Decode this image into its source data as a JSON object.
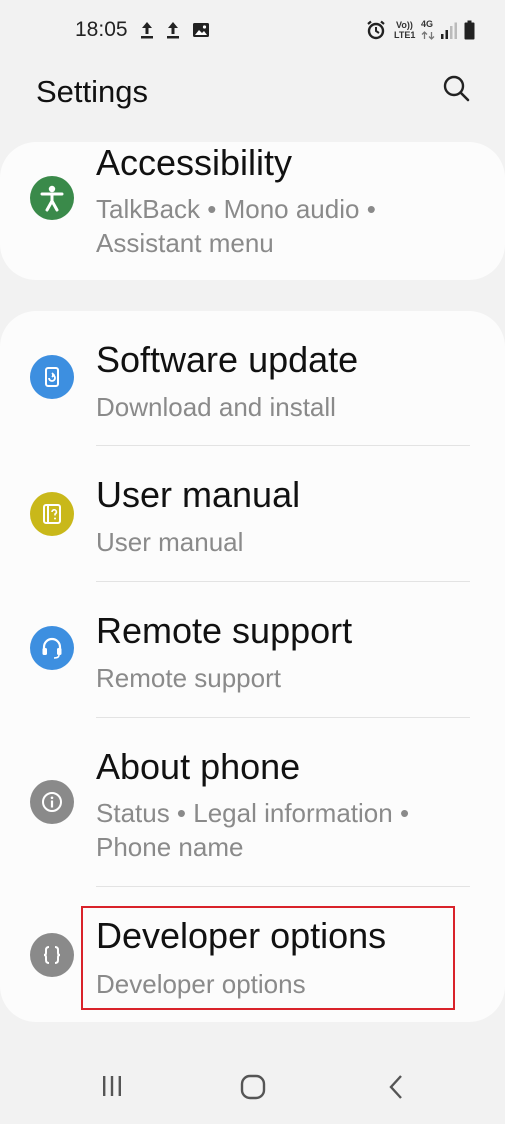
{
  "status_bar": {
    "time": "18:05",
    "left_icons": [
      "upload-icon",
      "upload-icon",
      "image-icon"
    ],
    "right_icons": [
      "alarm-icon",
      "volte-icon",
      "4g-icon",
      "signal-icon",
      "battery-icon"
    ],
    "volte_label_1": "Vo))",
    "volte_label_2": "LTE1",
    "network_label": "4G"
  },
  "header": {
    "title": "Settings",
    "search_icon": "search-icon"
  },
  "accessibility": {
    "title": "Accessibility",
    "subtitle": "TalkBack  •  Mono audio  •  Assistant menu",
    "icon": "accessibility-icon",
    "icon_color": "#3a8a4a"
  },
  "items": [
    {
      "title": "Software update",
      "subtitle": "Download and install",
      "icon": "software-update-icon",
      "icon_color": "#3d8fe0"
    },
    {
      "title": "User manual",
      "subtitle": "User manual",
      "icon": "user-manual-icon",
      "icon_color": "#c9b81a"
    },
    {
      "title": "Remote support",
      "subtitle": "Remote support",
      "icon": "headset-icon",
      "icon_color": "#3d8fe0"
    },
    {
      "title": "About phone",
      "subtitle": "Status  •  Legal information  •  Phone name",
      "icon": "info-icon",
      "icon_color": "#8a8a8a"
    },
    {
      "title": "Developer options",
      "subtitle": "Developer options",
      "icon": "braces-icon",
      "icon_color": "#8a8a8a"
    }
  ],
  "highlight_color": "#d9222a",
  "nav_bar": {
    "icons": [
      "recents-icon",
      "home-icon",
      "back-icon"
    ]
  }
}
